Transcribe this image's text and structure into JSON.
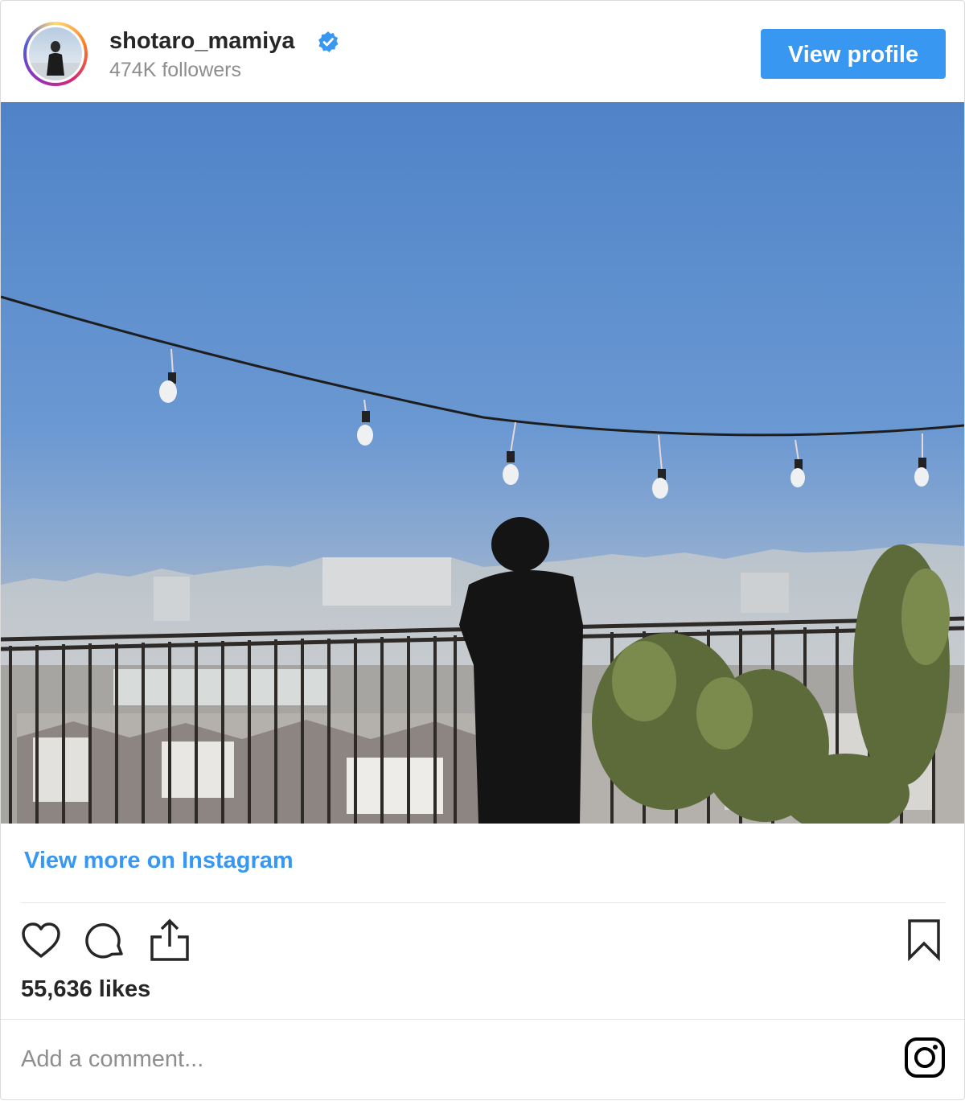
{
  "post": {
    "username": "shotaro_mamiya",
    "followers": "474K followers",
    "verified_icon": "verified-badge-icon",
    "view_profile_label": "View profile",
    "view_more_label": "View more on Instagram",
    "likes": "55,636 likes",
    "comment_placeholder": "Add a comment..."
  },
  "actions": {
    "like_icon": "heart-icon",
    "comment_icon": "comment-bubble-icon",
    "share_icon": "share-icon",
    "save_icon": "bookmark-icon",
    "brand_icon": "instagram-logo-icon"
  },
  "colors": {
    "accent": "#3897f0",
    "text": "#262626",
    "muted": "#8e8e8e",
    "border": "#dbdbdb"
  }
}
